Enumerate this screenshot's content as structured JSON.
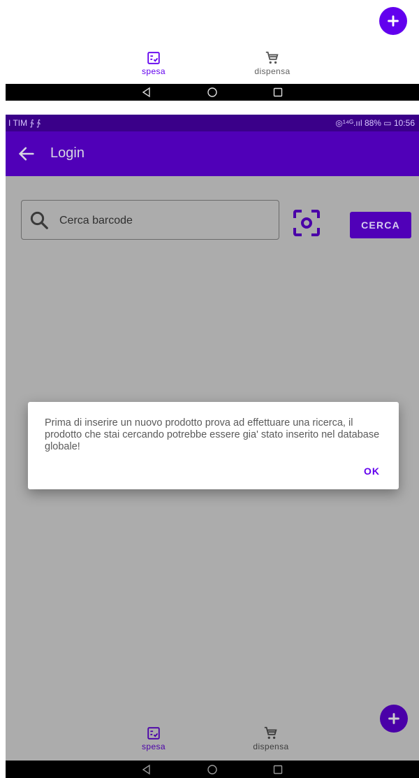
{
  "top_screen": {
    "nav": [
      {
        "label": "spesa",
        "icon": "list-check-icon",
        "active": true
      },
      {
        "label": "dispensa",
        "icon": "cart-icon",
        "active": false
      }
    ]
  },
  "status_bar": {
    "carrier": "I TIM ∱ ∱",
    "right": "◎¹⁴ᴳ.ııl 88% ▭ 10:56",
    "battery_percent": "88%",
    "time": "10:56"
  },
  "app_bar": {
    "title": "Login"
  },
  "search": {
    "placeholder": "Cerca barcode",
    "value": "",
    "button_label": "CERCA"
  },
  "dialog": {
    "message": "Prima di inserire un nuovo prodotto prova ad effettuare una ricerca, il prodotto che stai cercando potrebbe essere gia' stato inserito nel database globale!",
    "ok_label": "OK"
  },
  "bottom_nav": [
    {
      "label": "spesa",
      "icon": "list-check-icon",
      "active": true
    },
    {
      "label": "dispensa",
      "icon": "cart-icon",
      "active": false
    }
  ],
  "colors": {
    "accent": "#6200ee",
    "app_bar": "#5000b8",
    "status_bar": "#3a0089",
    "scrim_background": "#acacac"
  }
}
